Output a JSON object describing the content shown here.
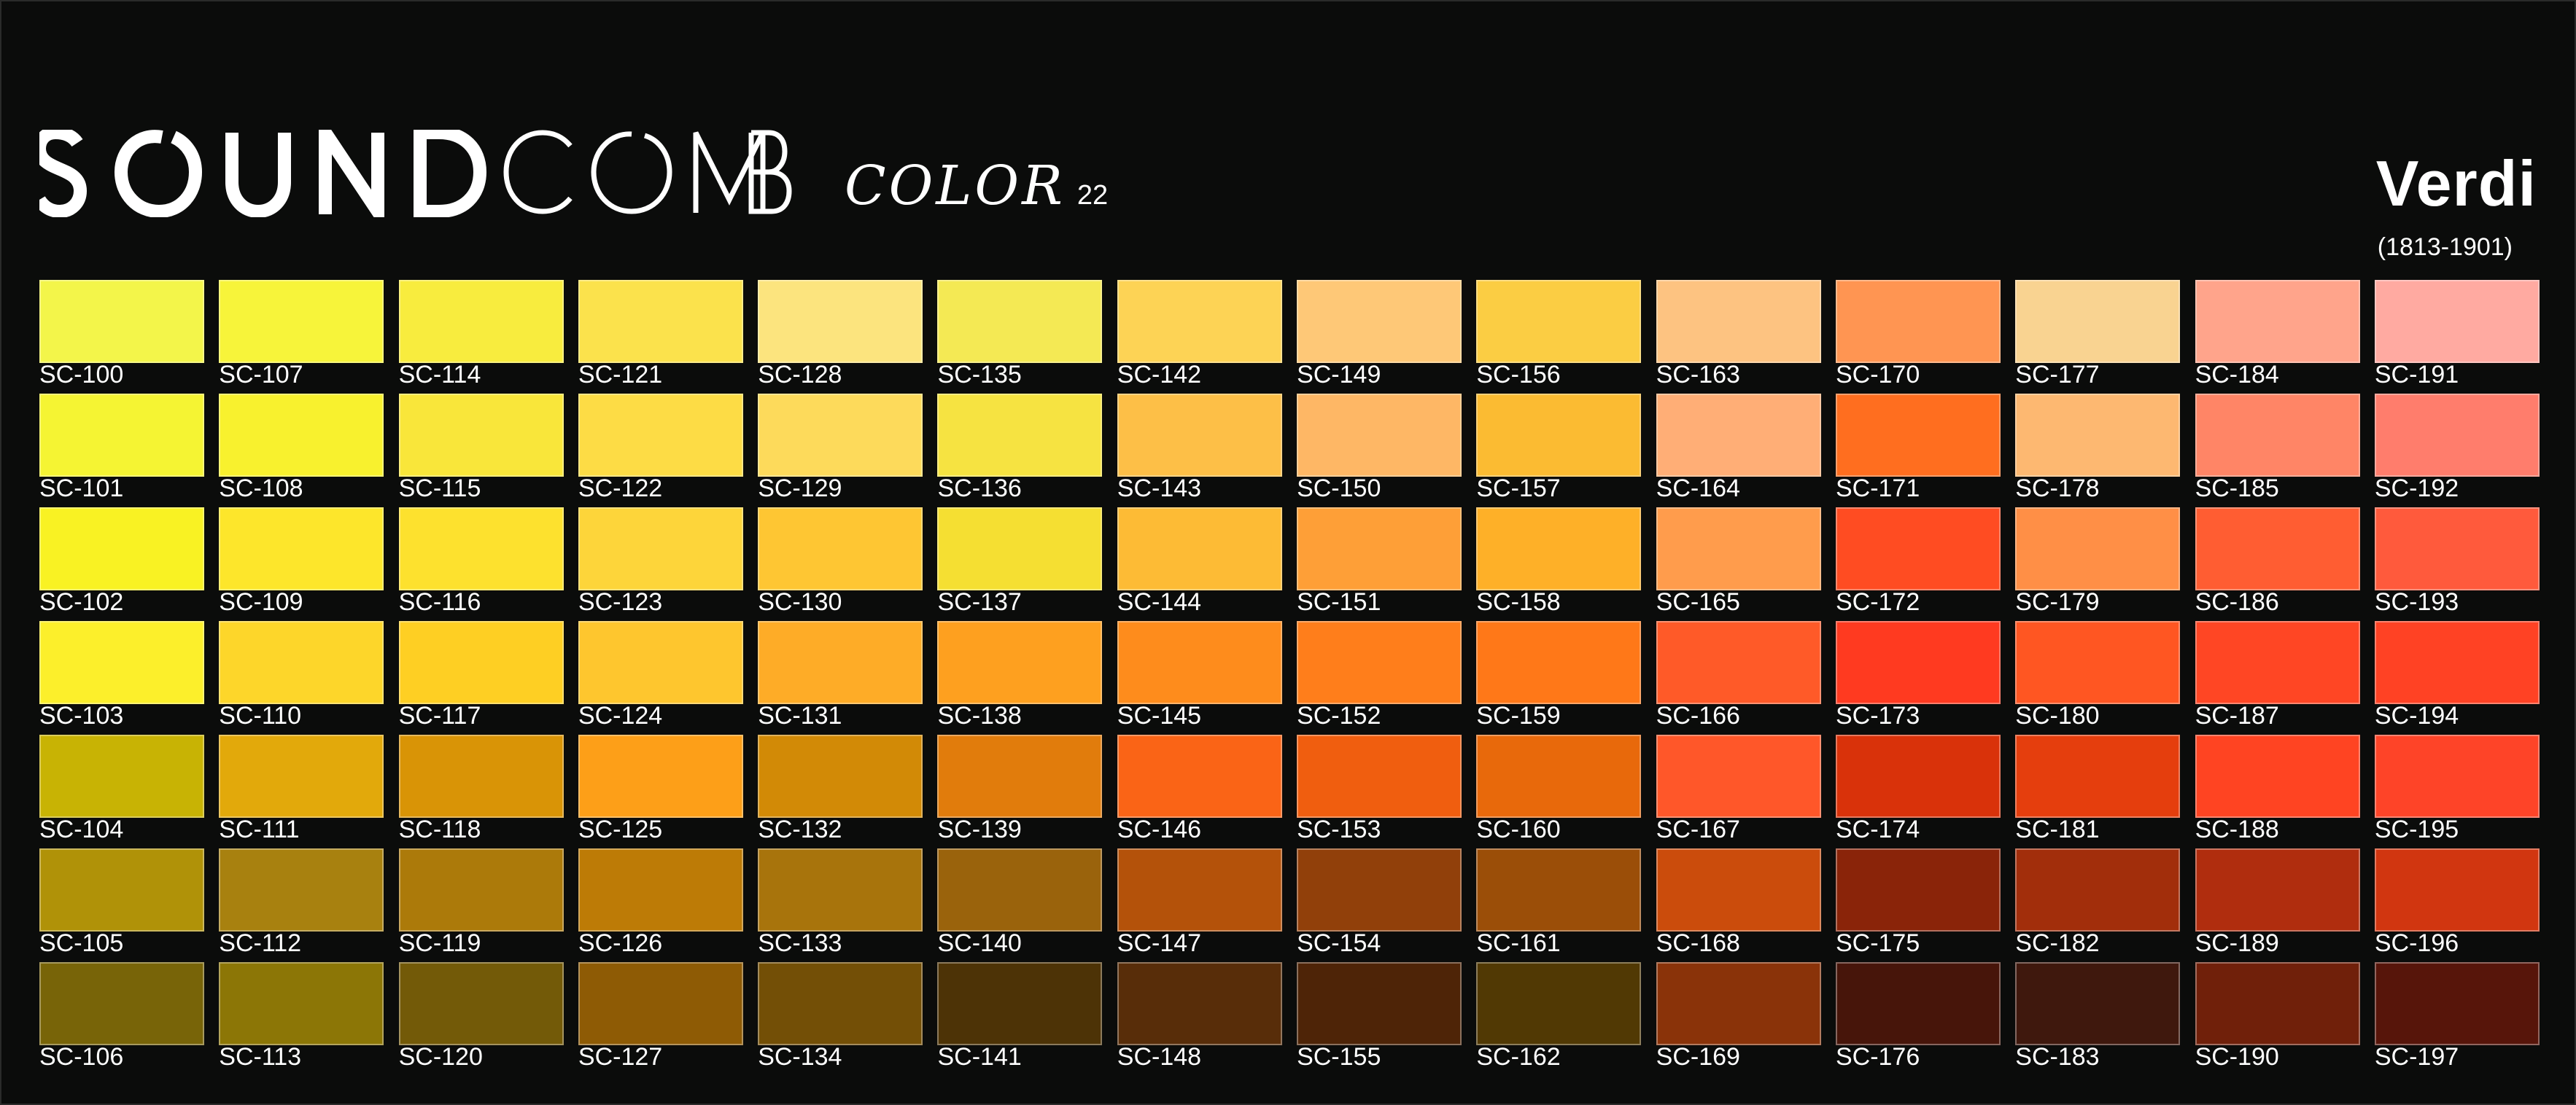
{
  "brand": {
    "name": "SOUNDCOMB",
    "sub": "COLOR",
    "number": "22"
  },
  "composer": {
    "name": "Verdi",
    "dates": "(1813-1901)"
  },
  "swatch_rows": [
    [
      {
        "code": "SC-100",
        "color": "#f3f54a"
      },
      {
        "code": "SC-107",
        "color": "#f7f43a"
      },
      {
        "code": "SC-114",
        "color": "#f8ec3e"
      },
      {
        "code": "SC-121",
        "color": "#fbe24c"
      },
      {
        "code": "SC-128",
        "color": "#fce47e"
      },
      {
        "code": "SC-135",
        "color": "#f4e954"
      },
      {
        "code": "SC-142",
        "color": "#fdd355"
      },
      {
        "code": "SC-149",
        "color": "#fec877"
      },
      {
        "code": "SC-156",
        "color": "#fbcd43"
      },
      {
        "code": "SC-163",
        "color": "#fdc381"
      },
      {
        "code": "SC-170",
        "color": "#ff9552"
      },
      {
        "code": "SC-177",
        "color": "#f9d391"
      },
      {
        "code": "SC-184",
        "color": "#ffa48b"
      },
      {
        "code": "SC-191",
        "color": "#ffaaa1"
      }
    ],
    [
      {
        "code": "SC-101",
        "color": "#f5f433"
      },
      {
        "code": "SC-108",
        "color": "#f8f12e"
      },
      {
        "code": "SC-115",
        "color": "#f9e63a"
      },
      {
        "code": "SC-122",
        "color": "#fddc45"
      },
      {
        "code": "SC-129",
        "color": "#fdda5b"
      },
      {
        "code": "SC-136",
        "color": "#f6e341"
      },
      {
        "code": "SC-143",
        "color": "#fdbf47"
      },
      {
        "code": "SC-150",
        "color": "#feb765"
      },
      {
        "code": "SC-157",
        "color": "#fbbb32"
      },
      {
        "code": "SC-164",
        "color": "#ffae76"
      },
      {
        "code": "SC-171",
        "color": "#ff6e1f"
      },
      {
        "code": "SC-178",
        "color": "#fdb871"
      },
      {
        "code": "SC-185",
        "color": "#ff8566"
      },
      {
        "code": "SC-192",
        "color": "#ff7d6c"
      }
    ],
    [
      {
        "code": "SC-102",
        "color": "#f9f223"
      },
      {
        "code": "SC-109",
        "color": "#fde62b"
      },
      {
        "code": "SC-116",
        "color": "#fde12e"
      },
      {
        "code": "SC-123",
        "color": "#fdd53a"
      },
      {
        "code": "SC-130",
        "color": "#fec633"
      },
      {
        "code": "SC-137",
        "color": "#f5df32"
      },
      {
        "code": "SC-144",
        "color": "#fdbb35"
      },
      {
        "code": "SC-151",
        "color": "#fe9f37"
      },
      {
        "code": "SC-158",
        "color": "#feb028"
      },
      {
        "code": "SC-165",
        "color": "#ff9c4c"
      },
      {
        "code": "SC-172",
        "color": "#ff4c22"
      },
      {
        "code": "SC-179",
        "color": "#ff8f46"
      },
      {
        "code": "SC-186",
        "color": "#ff5d32"
      },
      {
        "code": "SC-193",
        "color": "#ff5a3c"
      }
    ],
    [
      {
        "code": "SC-103",
        "color": "#fcef2b"
      },
      {
        "code": "SC-110",
        "color": "#fdd62a"
      },
      {
        "code": "SC-117",
        "color": "#fecf23"
      },
      {
        "code": "SC-124",
        "color": "#fec62e"
      },
      {
        "code": "SC-131",
        "color": "#feac27"
      },
      {
        "code": "SC-138",
        "color": "#fea01f"
      },
      {
        "code": "SC-145",
        "color": "#fe8c1c"
      },
      {
        "code": "SC-152",
        "color": "#ff7e1b"
      },
      {
        "code": "SC-159",
        "color": "#ff7818"
      },
      {
        "code": "SC-166",
        "color": "#ff5a28"
      },
      {
        "code": "SC-173",
        "color": "#ff3a20"
      },
      {
        "code": "SC-180",
        "color": "#ff5622"
      },
      {
        "code": "SC-187",
        "color": "#ff4624"
      },
      {
        "code": "SC-194",
        "color": "#ff4224"
      }
    ],
    [
      {
        "code": "SC-104",
        "color": "#c8b304"
      },
      {
        "code": "SC-111",
        "color": "#e2a90b"
      },
      {
        "code": "SC-118",
        "color": "#d99406"
      },
      {
        "code": "SC-125",
        "color": "#fd9f18"
      },
      {
        "code": "SC-132",
        "color": "#d28a06"
      },
      {
        "code": "SC-139",
        "color": "#e17c0c"
      },
      {
        "code": "SC-146",
        "color": "#fa6416"
      },
      {
        "code": "SC-153",
        "color": "#f05e0f"
      },
      {
        "code": "SC-160",
        "color": "#e8690b"
      },
      {
        "code": "SC-167",
        "color": "#ff5729"
      },
      {
        "code": "SC-174",
        "color": "#d9320a"
      },
      {
        "code": "SC-181",
        "color": "#e53e0d"
      },
      {
        "code": "SC-188",
        "color": "#ff4422"
      },
      {
        "code": "SC-195",
        "color": "#fe4428"
      }
    ],
    [
      {
        "code": "SC-105",
        "color": "#b09208"
      },
      {
        "code": "SC-112",
        "color": "#a8810f"
      },
      {
        "code": "SC-119",
        "color": "#ac7a0a"
      },
      {
        "code": "SC-126",
        "color": "#bd7b06"
      },
      {
        "code": "SC-133",
        "color": "#a8740c"
      },
      {
        "code": "SC-140",
        "color": "#9a630c"
      },
      {
        "code": "SC-147",
        "color": "#b4520a"
      },
      {
        "code": "SC-154",
        "color": "#91400a"
      },
      {
        "code": "SC-161",
        "color": "#9b4e08"
      },
      {
        "code": "SC-168",
        "color": "#cb4c0c"
      },
      {
        "code": "SC-175",
        "color": "#8a2409"
      },
      {
        "code": "SC-182",
        "color": "#a22e0b"
      },
      {
        "code": "SC-189",
        "color": "#b02d0e"
      },
      {
        "code": "SC-196",
        "color": "#d13610"
      }
    ],
    [
      {
        "code": "SC-106",
        "color": "#786408"
      },
      {
        "code": "SC-113",
        "color": "#8c7606"
      },
      {
        "code": "SC-120",
        "color": "#735a08"
      },
      {
        "code": "SC-127",
        "color": "#8e5b05"
      },
      {
        "code": "SC-134",
        "color": "#734f06"
      },
      {
        "code": "SC-141",
        "color": "#4d3306"
      },
      {
        "code": "SC-148",
        "color": "#582d09"
      },
      {
        "code": "SC-155",
        "color": "#4e2407"
      },
      {
        "code": "SC-162",
        "color": "#513904"
      },
      {
        "code": "SC-169",
        "color": "#8a3309"
      },
      {
        "code": "SC-176",
        "color": "#47150a"
      },
      {
        "code": "SC-183",
        "color": "#3f180d"
      },
      {
        "code": "SC-190",
        "color": "#70200a"
      },
      {
        "code": "SC-197",
        "color": "#57150a"
      }
    ]
  ]
}
